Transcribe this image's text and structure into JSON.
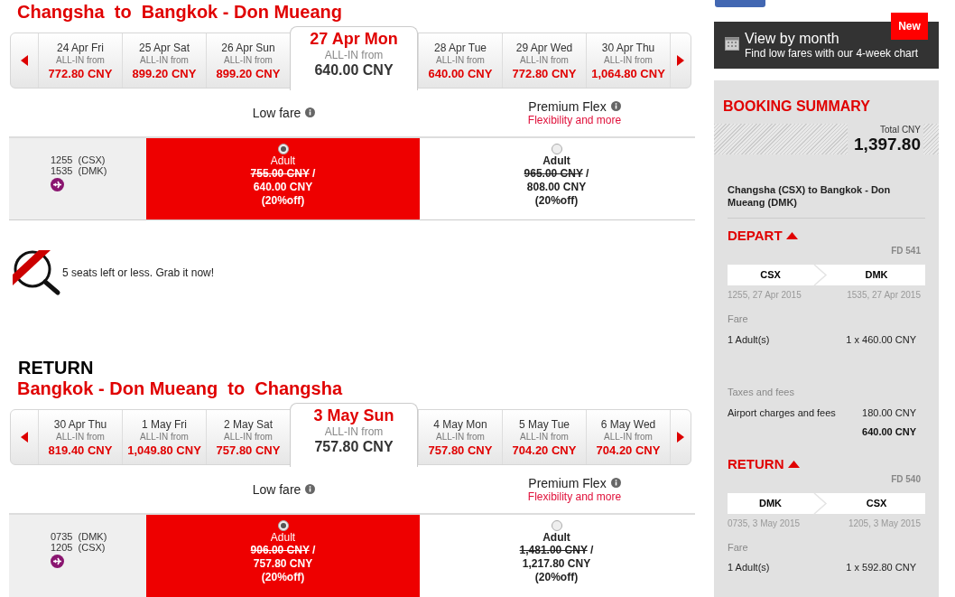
{
  "flights": [
    {
      "route": "Changsha  to  Bangkok - Don Mueang",
      "dates": [
        {
          "date": "24 Apr Fri",
          "label": "ALL-IN from",
          "price": "772.80 CNY",
          "selected": false
        },
        {
          "date": "25 Apr Sat",
          "label": "ALL-IN from",
          "price": "899.20 CNY",
          "selected": false
        },
        {
          "date": "26 Apr Sun",
          "label": "ALL-IN from",
          "price": "899.20 CNY",
          "selected": false
        },
        {
          "date": "27 Apr Mon",
          "label": "ALL-IN from",
          "price": "640.00 CNY",
          "selected": true
        },
        {
          "date": "28 Apr Tue",
          "label": "ALL-IN from",
          "price": "640.00 CNY",
          "selected": false
        },
        {
          "date": "29 Apr Wed",
          "label": "ALL-IN from",
          "price": "772.80 CNY",
          "selected": false
        },
        {
          "date": "30 Apr Thu",
          "label": "ALL-IN from",
          "price": "1,064.80 CNY",
          "selected": false
        }
      ],
      "fare_classes": [
        {
          "name": "Low fare"
        },
        {
          "name": "Premium Flex",
          "subtitle": "Flexibility and more"
        }
      ],
      "times": [
        "1255  (CSX)",
        "1535  (DMK)"
      ],
      "fares": [
        {
          "label": "Adult",
          "old": "755.00 CNY",
          "separator": "/",
          "new": "640.00 CNY",
          "discount": "(20%off)",
          "selected": true
        },
        {
          "label": "Adult",
          "old": "965.00 CNY",
          "separator": "/",
          "new": "808.00 CNY",
          "discount": "(20%off)",
          "selected": false
        }
      ],
      "notice": "5 seats left or less. Grab it now!"
    },
    {
      "heading": "RETURN",
      "route": "Bangkok - Don Mueang  to  Changsha",
      "dates": [
        {
          "date": "30 Apr Thu",
          "label": "ALL-IN from",
          "price": "819.40 CNY",
          "selected": false
        },
        {
          "date": "1 May Fri",
          "label": "ALL-IN from",
          "price": "1,049.80 CNY",
          "selected": false
        },
        {
          "date": "2 May Sat",
          "label": "ALL-IN from",
          "price": "757.80 CNY",
          "selected": false
        },
        {
          "date": "3 May Sun",
          "label": "ALL-IN from",
          "price": "757.80 CNY",
          "selected": true
        },
        {
          "date": "4 May Mon",
          "label": "ALL-IN from",
          "price": "757.80 CNY",
          "selected": false
        },
        {
          "date": "5 May Tue",
          "label": "ALL-IN from",
          "price": "704.20 CNY",
          "selected": false
        },
        {
          "date": "6 May Wed",
          "label": "ALL-IN from",
          "price": "704.20 CNY",
          "selected": false
        }
      ],
      "fare_classes": [
        {
          "name": "Low fare"
        },
        {
          "name": "Premium Flex",
          "subtitle": "Flexibility and more"
        }
      ],
      "times": [
        "0735  (DMK)",
        "1205  (CSX)"
      ],
      "fares": [
        {
          "label": "Adult",
          "old": "906.00 CNY",
          "separator": "/",
          "new": "757.80 CNY",
          "discount": "(20%off)",
          "selected": true
        },
        {
          "label": "Adult",
          "old": "1,481.00 CNY",
          "separator": "/",
          "new": "1,217.80 CNY",
          "discount": "(20%off)",
          "selected": false
        }
      ]
    }
  ],
  "promo": {
    "title": "View by month",
    "subtitle": "Find low fares with our 4-week chart",
    "badge": "New"
  },
  "summary": {
    "title": "BOOKING SUMMARY",
    "total_label": "Total CNY",
    "total": "1,397.80",
    "route": "Changsha (CSX) to Bangkok - Don Mueang (DMK)",
    "sections": [
      {
        "title": "DEPART",
        "flight_no": "FD 541",
        "from": "CSX",
        "to": "DMK",
        "from_time": "1255, 27 Apr 2015",
        "to_time": "1535, 27 Apr 2015",
        "fare_label": "Fare",
        "fare_rows": [
          {
            "label": "1 Adult(s)",
            "value": "1 x 460.00 CNY"
          }
        ],
        "taxes_label": "Taxes and fees",
        "tax_rows": [
          {
            "label": "Airport charges and fees",
            "value": "180.00 CNY"
          }
        ],
        "subtotal": "640.00 CNY"
      },
      {
        "title": "RETURN",
        "flight_no": "FD 540",
        "from": "DMK",
        "to": "CSX",
        "from_time": "0735, 3 May 2015",
        "to_time": "1205, 3 May 2015",
        "fare_label": "Fare",
        "fare_rows": [
          {
            "label": "1 Adult(s)",
            "value": "1 x 592.80 CNY"
          }
        ]
      }
    ]
  }
}
